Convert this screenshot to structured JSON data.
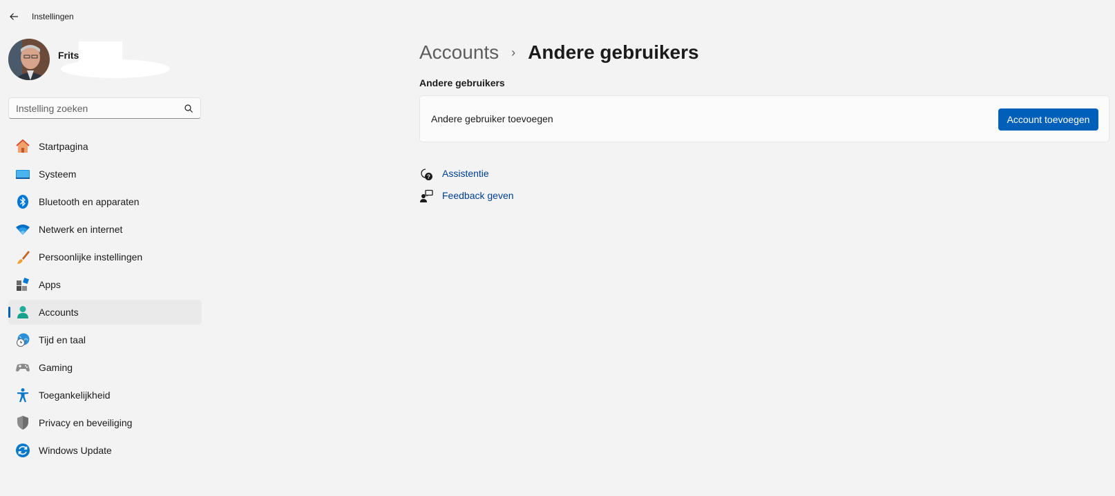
{
  "window": {
    "title": "Instellingen"
  },
  "profile": {
    "name": "Frits"
  },
  "search": {
    "placeholder": "Instelling zoeken"
  },
  "sidebar": {
    "items": [
      {
        "label": "Startpagina",
        "icon": "home-icon"
      },
      {
        "label": "Systeem",
        "icon": "system-icon"
      },
      {
        "label": "Bluetooth en apparaten",
        "icon": "bluetooth-icon"
      },
      {
        "label": "Netwerk en internet",
        "icon": "wifi-icon"
      },
      {
        "label": "Persoonlijke instellingen",
        "icon": "brush-icon"
      },
      {
        "label": "Apps",
        "icon": "apps-icon"
      },
      {
        "label": "Accounts",
        "icon": "accounts-icon",
        "selected": true
      },
      {
        "label": "Tijd en taal",
        "icon": "globe-clock-icon"
      },
      {
        "label": "Gaming",
        "icon": "gamepad-icon"
      },
      {
        "label": "Toegankelijkheid",
        "icon": "accessibility-icon"
      },
      {
        "label": "Privacy en beveiliging",
        "icon": "shield-icon"
      },
      {
        "label": "Windows Update",
        "icon": "update-icon"
      }
    ]
  },
  "breadcrumb": {
    "parent": "Accounts",
    "separator": "›",
    "current": "Andere gebruikers"
  },
  "section": {
    "title": "Andere gebruikers",
    "card": {
      "label": "Andere gebruiker toevoegen",
      "button": "Account toevoegen"
    }
  },
  "links": [
    {
      "label": "Assistentie",
      "icon": "help-icon"
    },
    {
      "label": "Feedback geven",
      "icon": "feedback-icon"
    }
  ],
  "colors": {
    "accent": "#005fb8",
    "link": "#003e92",
    "background": "#f3f3f3"
  }
}
